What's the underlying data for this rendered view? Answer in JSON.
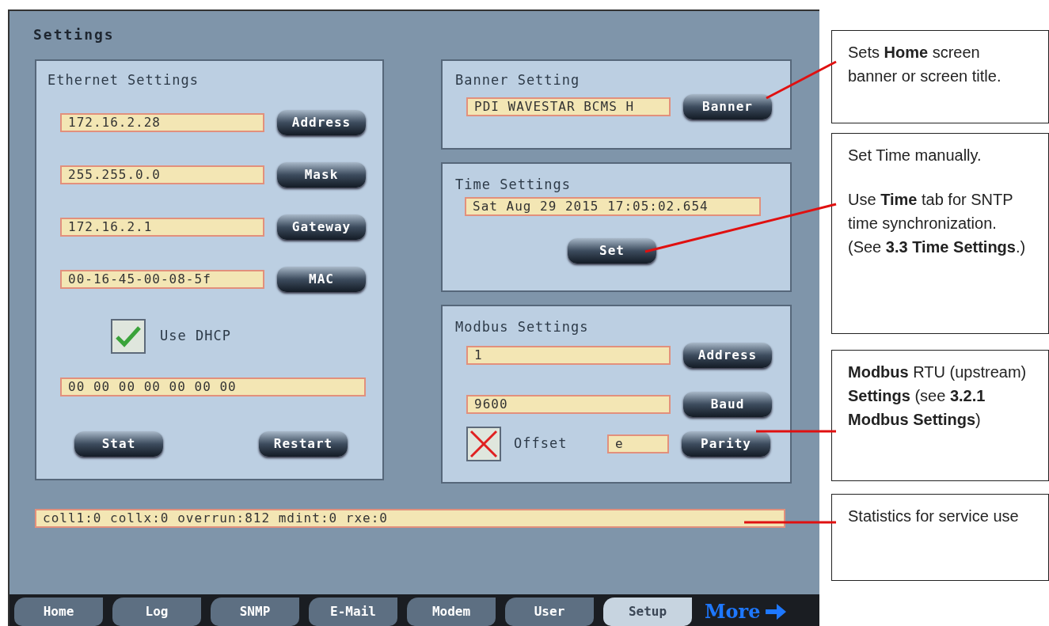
{
  "screen": {
    "title": "Settings",
    "ethernet": {
      "title": "Ethernet Settings",
      "rows": [
        {
          "value": "172.16.2.28",
          "button": "Address"
        },
        {
          "value": "255.255.0.0",
          "button": "Mask"
        },
        {
          "value": "172.16.2.1",
          "button": "Gateway"
        },
        {
          "value": "00-16-45-00-08-5f",
          "button": "MAC"
        }
      ],
      "dhcp": {
        "label": "Use DHCP",
        "checked": true
      },
      "hex_field": "00 00 00 00 00 00 00",
      "buttons": [
        "Stat",
        "Restart"
      ]
    },
    "banner": {
      "title": "Banner Setting",
      "value": "PDI WAVESTAR BCMS H",
      "button": "Banner"
    },
    "time": {
      "title": "Time Settings",
      "value": "Sat Aug 29 2015 17:05:02.654",
      "button": "Set"
    },
    "modbus": {
      "title": "Modbus Settings",
      "rows": [
        {
          "value": "1",
          "button": "Address"
        },
        {
          "value": "9600",
          "button": "Baud"
        }
      ],
      "offset": {
        "label": "Offset",
        "checked": false
      },
      "parity": {
        "value": "e",
        "button": "Parity"
      }
    },
    "stats": "coll1:0 collx:0 overrun:812 mdint:0 rxe:0",
    "tabs": [
      {
        "label": "Home",
        "kind": "tab",
        "selected": false
      },
      {
        "label": "Log",
        "kind": "tab",
        "selected": false
      },
      {
        "label": "SNMP",
        "kind": "tab",
        "selected": false
      },
      {
        "label": "E-Mail",
        "kind": "tab",
        "selected": false
      },
      {
        "label": "Modem",
        "kind": "tab",
        "selected": false
      },
      {
        "label": "User",
        "kind": "tab",
        "selected": false
      },
      {
        "label": "Setup",
        "kind": "tab",
        "selected": true
      },
      {
        "label": "More",
        "kind": "more",
        "selected": false
      }
    ]
  },
  "callouts": [
    {
      "paragraphs": [
        "Sets **Home** screen banner or screen title."
      ]
    },
    {
      "paragraphs": [
        "Set Time manually.",
        "Use **Time** tab for SNTP time synchronization. (See **3.3 Time Settings**.)"
      ]
    },
    {
      "paragraphs": [
        "**Modbus** RTU (upstream) **Settings** (see **3.2.1 Modbus Settings**)"
      ]
    },
    {
      "paragraphs": [
        "Statistics for service use"
      ]
    }
  ]
}
